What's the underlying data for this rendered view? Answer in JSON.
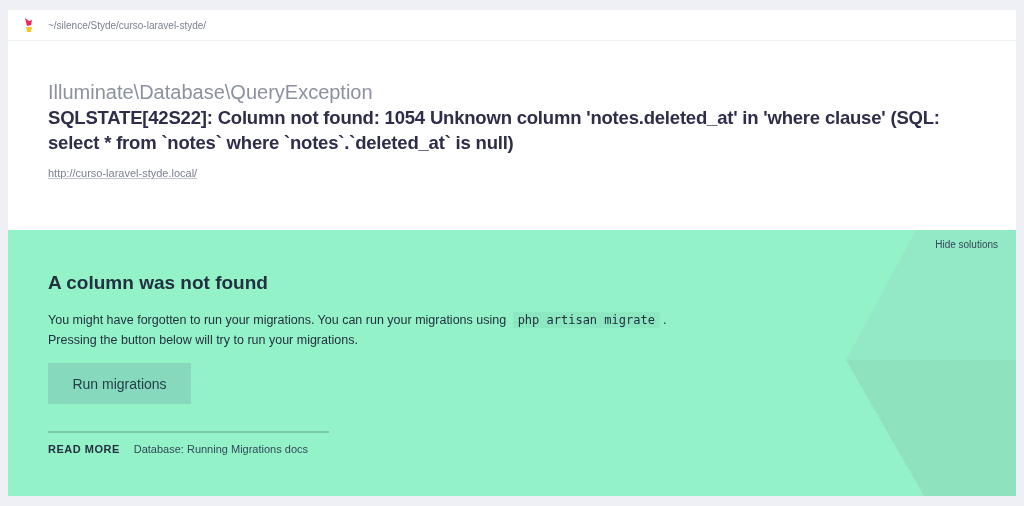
{
  "header": {
    "path": "~/silence/Styde/curso-laravel-styde/"
  },
  "exception": {
    "class": "Illuminate\\Database\\QueryException",
    "message": "SQLSTATE[42S22]: Column not found: 1054 Unknown column 'notes.deleted_at' in 'where clause' (SQL: select * from `notes` where `notes`.`deleted_at` is null)",
    "url": "http://curso-laravel-styde.local/"
  },
  "solution": {
    "hide_link": "Hide solutions",
    "title": "A column was not found",
    "description": {
      "before": "You might have forgotten to run your migrations. You can run your migrations using ",
      "code": "php artisan migrate",
      "after": "."
    },
    "description_line_2": "Pressing the button below will try to run your migrations.",
    "button": "Run migrations",
    "read_more_label": "READ MORE",
    "links": [
      "Database: Running Migrations docs"
    ]
  }
}
